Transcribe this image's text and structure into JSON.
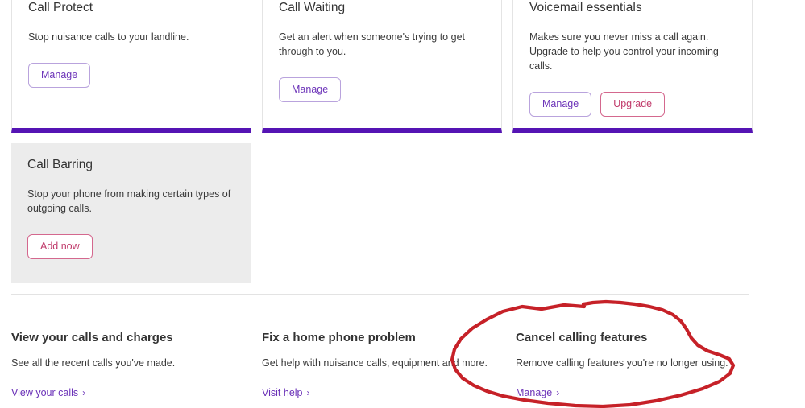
{
  "theme": {
    "accent_purple": "#5514b4",
    "link_purple": "#6b32b8",
    "accent_pink": "#c0396a",
    "card_grey": "#ececec",
    "annotation_red": "#c62128"
  },
  "feature_cards": [
    {
      "title": "Call Protect",
      "description": "Stop nuisance calls to your landline.",
      "style": "white",
      "buttons": [
        {
          "label": "Manage",
          "style": "purple"
        }
      ]
    },
    {
      "title": "Call Waiting",
      "description": "Get an alert when someone's trying to get through to you.",
      "style": "white",
      "buttons": [
        {
          "label": "Manage",
          "style": "purple"
        }
      ]
    },
    {
      "title": "Voicemail essentials",
      "description": "Makes sure you never miss a call again. Upgrade to help you control your incoming calls.",
      "style": "white",
      "buttons": [
        {
          "label": "Manage",
          "style": "purple"
        },
        {
          "label": "Upgrade",
          "style": "pink"
        }
      ]
    },
    {
      "title": "Call Barring",
      "description": "Stop your phone from making certain types of outgoing calls.",
      "style": "grey",
      "buttons": [
        {
          "label": "Add now",
          "style": "pink"
        }
      ]
    }
  ],
  "link_sections": [
    {
      "title": "View your calls and charges",
      "description": "See all the recent calls you've made.",
      "cta_label": "View your calls",
      "cta_chevron": "›"
    },
    {
      "title": "Fix a home phone problem",
      "description": "Get help with nuisance calls, equipment and more.",
      "cta_label": "Visit help",
      "cta_chevron": "›"
    },
    {
      "title": "Cancel calling features",
      "description": "Remove calling features you're no longer using.",
      "cta_label": "Manage",
      "cta_chevron": "›"
    }
  ],
  "annotation": {
    "type": "freehand-circle",
    "color": "#c62128",
    "target": "Cancel calling features"
  }
}
